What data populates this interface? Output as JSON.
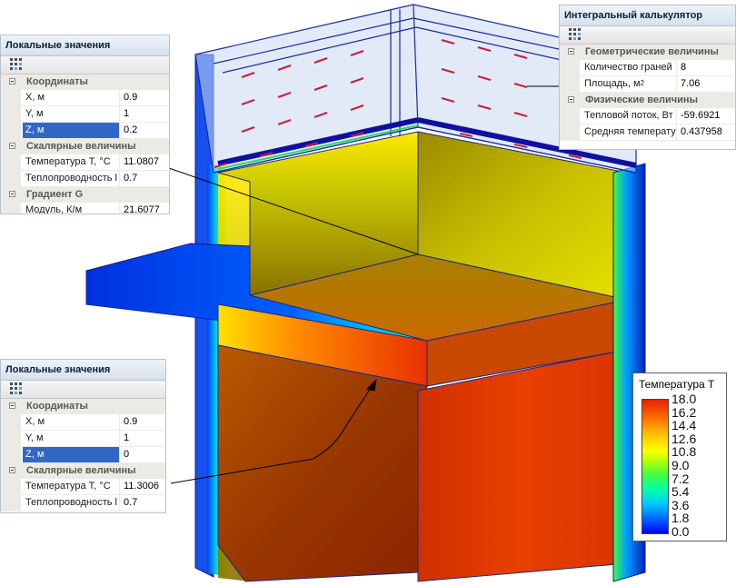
{
  "panel_top_left": {
    "title": "Локальные значения",
    "sec_coords": "Координаты",
    "x_label": "X, м",
    "x_value": "0.9",
    "y_label": "Y, м",
    "y_value": "1",
    "z_label": "Z, м",
    "z_value": "0.2",
    "sec_scalar": "Скалярные величины",
    "temp_label": "Температура T, °C",
    "temp_value": "11.0807",
    "cond_label": "Теплопроводность l",
    "cond_value": "0.7",
    "sec_gradient": "Градиент G",
    "mod_label": "Модуль, К/м",
    "mod_value": "21.6077"
  },
  "panel_bottom_left": {
    "title": "Локальные значения",
    "sec_coords": "Координаты",
    "x_label": "X, м",
    "x_value": "0.9",
    "y_label": "Y, м",
    "y_value": "1",
    "z_label": "Z, м",
    "z_value": "0",
    "sec_scalar": "Скалярные величины",
    "temp_label": "Температура T, °C",
    "temp_value": "11.3006",
    "cond_label": "Теплопроводность l",
    "cond_value": "0.7"
  },
  "panel_integral": {
    "title": "Интегральный калькулятор",
    "sec_geom": "Геометрические величины",
    "faces_label": "Количество граней",
    "faces_value": "8",
    "area_label": "Площадь, м",
    "area_sup": "2",
    "area_value": "7.06",
    "sec_phys": "Физические величины",
    "flux_label": "Тепловой поток, Вт",
    "flux_value": "-59.6921",
    "avgtemp_label": "Средняя температура",
    "avgtemp_value": "0.437958"
  },
  "legend": {
    "title": "Температура T",
    "ticks": [
      "18.0",
      "16.2",
      "14.4",
      "12.6",
      "10.8",
      "9.0",
      "7.2",
      "5.4",
      "3.6",
      "1.8",
      "0.0"
    ]
  },
  "colors": {
    "hot": "#e02000",
    "warm": "#ff9000",
    "mid": "#ffff00",
    "cool": "#00c8ff",
    "cold": "#0000ff",
    "arrow": "#c81e3c",
    "selection": "#3168c6"
  }
}
